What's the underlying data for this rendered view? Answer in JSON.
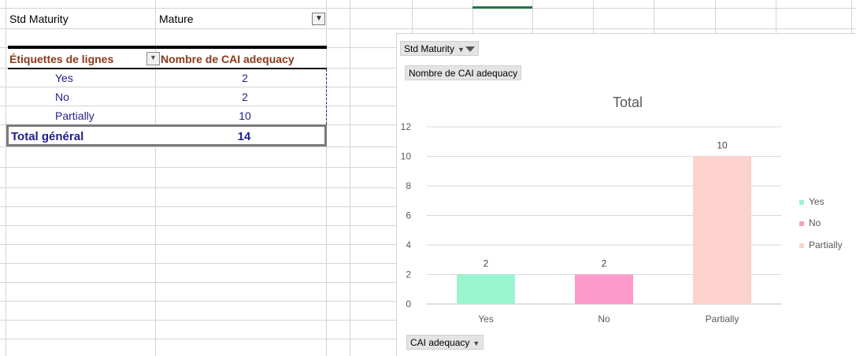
{
  "sheet": {
    "cell_a1": "Std Maturity",
    "cell_b1": "Mature",
    "filter_icon": "filter-dropdown-icon"
  },
  "pivot": {
    "row_header": "Étiquettes de lignes",
    "value_header": "Nombre de CAI adequacy",
    "dropdown_icon": "chevron-down-icon",
    "rows": [
      {
        "label": "Yes",
        "value": "2"
      },
      {
        "label": "No",
        "value": "2"
      },
      {
        "label": "Partially",
        "value": "10"
      }
    ],
    "total_label": "Total général",
    "total_value": "14",
    "colors": {
      "header": "#8b3a1a",
      "text": "#1f1f8a"
    }
  },
  "chart": {
    "filter_button": "Std Maturity",
    "values_button": "Nombre de CAI adequacy",
    "axis_button": "CAI adequacy"
  },
  "chart_data": {
    "type": "bar",
    "title": "Total",
    "categories": [
      "Yes",
      "No",
      "Partially"
    ],
    "values": [
      2,
      2,
      10
    ],
    "data_labels": [
      "2",
      "2",
      "10"
    ],
    "colors": [
      "#99f5cf",
      "#fc9bcb",
      "#fdd1cc"
    ],
    "ylim": [
      0,
      12
    ],
    "yticks": [
      "0",
      "2",
      "4",
      "6",
      "8",
      "10",
      "12"
    ],
    "grid": true,
    "legend": "right",
    "legend_entries": [
      "Yes",
      "No",
      "Partially"
    ]
  }
}
